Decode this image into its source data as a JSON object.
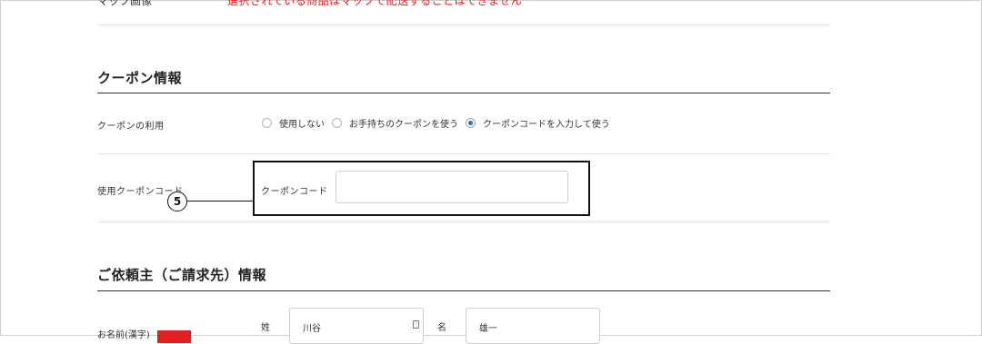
{
  "top_row": {
    "label": "マップ画像",
    "notice": "選択されている商品はマップで配送することはできません"
  },
  "coupon_section": {
    "title": "クーポン情報",
    "usage_label": "クーポンの利用",
    "options": [
      {
        "label": "使用しない",
        "checked": false
      },
      {
        "label": "お手持ちのクーポンを使う",
        "checked": false
      },
      {
        "label": "クーポンコードを入力して使う",
        "checked": true
      }
    ],
    "code_row_label": "使用クーポンコード",
    "code_field_label": "クーポンコード",
    "code_value": ""
  },
  "callout": {
    "number": "5"
  },
  "requester_section": {
    "title": "ご依頼主（ご請求先）情報",
    "name_row_label": "お名前(漢字)",
    "last_name_label": "姓",
    "last_name_value": "川谷",
    "first_name_label": "名",
    "first_name_value": "雄一"
  },
  "colors": {
    "accent_radio": "#2f6fa0",
    "notice_red": "#e02020",
    "callout_border": "#111111"
  }
}
